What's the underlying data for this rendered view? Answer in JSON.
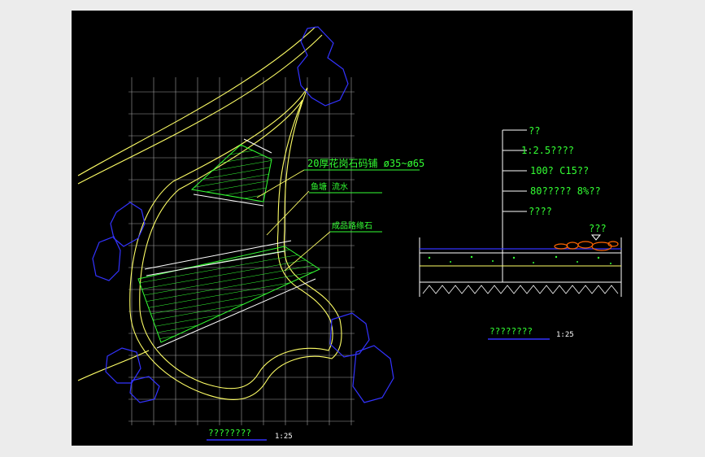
{
  "colors": {
    "background": "#000000",
    "frame": "#ececec",
    "grid": "#d9d9d9",
    "outline": "#ffff66",
    "hatch": "#33ff33",
    "annotation": "#33ff33",
    "boulder": "#3333ff",
    "white_line": "#ffffff",
    "pebbles": "#ff6600",
    "detail_text": "#33ff33",
    "title_underline": "#3333ff"
  },
  "plan": {
    "labels": {
      "stone": "20厚花岗石码铺 ø35~ø65",
      "water": "鱼塘 流水",
      "edge": "成品路缘石"
    },
    "title": "????????",
    "scale": "1:25"
  },
  "section": {
    "layers": [
      "??",
      "1:2.5????",
      "100? C15??",
      "80?????   8%??",
      "????"
    ],
    "pebble_label": "???",
    "title": "????????",
    "scale": "1:25"
  }
}
